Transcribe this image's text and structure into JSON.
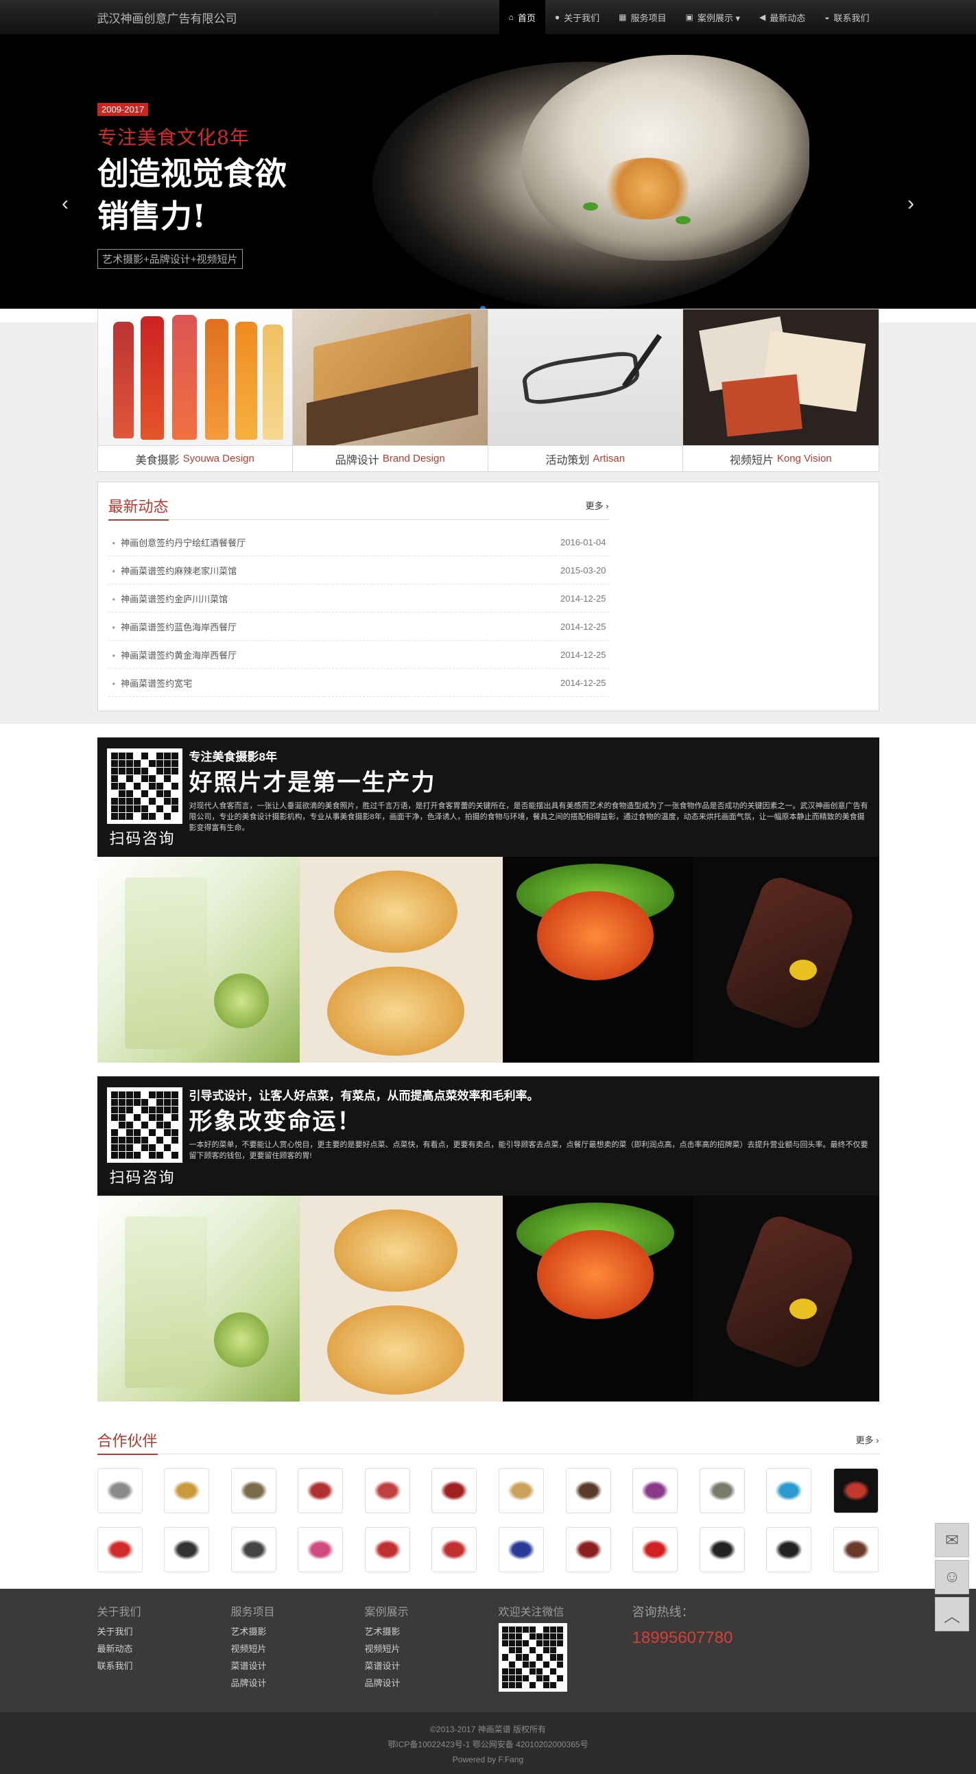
{
  "header": {
    "brand": "武汉神画创意广告有限公司",
    "nav": [
      {
        "label": "首页",
        "icon": "home-icon"
      },
      {
        "label": "关于我们",
        "icon": "user-icon"
      },
      {
        "label": "服务项目",
        "icon": "grid-icon"
      },
      {
        "label": "案例展示 ▾",
        "icon": "image-icon"
      },
      {
        "label": "最新动态",
        "icon": "megaphone-icon"
      },
      {
        "label": "联系我们",
        "icon": "car-icon"
      }
    ]
  },
  "hero": {
    "years": "2009-2017",
    "subtitle": "专注美食文化8年",
    "headline1": "创造视觉食欲",
    "headline2": "销售力!",
    "tag": "艺术摄影+品牌设计+视频短片"
  },
  "cards": [
    {
      "cn": "美食摄影",
      "en": "Syouwa Design"
    },
    {
      "cn": "品牌设计",
      "en": "Brand Design"
    },
    {
      "cn": "活动策划",
      "en": "Artisan"
    },
    {
      "cn": "视频短片",
      "en": "Kong Vision"
    }
  ],
  "news": {
    "title": "最新动态",
    "more": "更多 ›",
    "items": [
      {
        "title": "神画创意签约丹宁绘红酒餐餐厅",
        "date": "2016-01-04"
      },
      {
        "title": "神画菜谱签约麻辣老家川菜馆",
        "date": "2015-03-20"
      },
      {
        "title": "神画菜谱签约金庐川川菜馆",
        "date": "2014-12-25"
      },
      {
        "title": "神画菜谱签约蓝色海岸西餐厅",
        "date": "2014-12-25"
      },
      {
        "title": "神画菜谱签约黄金海岸西餐厅",
        "date": "2014-12-25"
      },
      {
        "title": "神画菜谱签约宽宅",
        "date": "2014-12-25"
      }
    ]
  },
  "promos": [
    {
      "line1": "专注美食摄影8年",
      "line2": "好照片才是第一生产力",
      "scan": "扫码咨询",
      "desc": "对现代人食客而言，一张让人垂涎欲滴的美食照片，胜过千言万语，是打开食客胃蕾的关键所在，是否能摆出具有美感而艺术的食物造型成为了一张食物作品是否成功的关键因素之一。武汉神画创意广告有限公司，专业的美食设计摄影机构，专业从事美食摄影8年，画面干净，色泽诱人，拍摄的食物与环境，餐具之间的搭配相得益彰，通过食物的温度，动态来烘托画面气氛，让一幅原本静止而精致的美食摄影变得富有生命。"
    },
    {
      "line1": "引导式设计，让客人好点菜，有菜点，从而提高点菜效率和毛利率。",
      "line2": "形象改变命运！",
      "scan": "扫码咨询",
      "desc": "一本好的菜单，不要能让人赏心悦目，更主要的是要好点菜、点菜快，有看点，更要有卖点，能引导顾客去点菜，点餐厅最想卖的菜（即利润点高，点击率高的招牌菜）去提升营业额与回头率。最终不仅要留下顾客的钱包，更要留住顾客的胃!"
    }
  ],
  "partners": {
    "title": "合作伙伴",
    "more": "更多 ›",
    "logo_colors": [
      "#8a8a8a",
      "#c89a3a",
      "#7a6b4a",
      "#b03030",
      "#c04040",
      "#a01f1f",
      "#c8a25a",
      "#5a3a2a",
      "#8a3a8a",
      "#7a7a6a",
      "#2a9ad0",
      "#c0392b",
      "#d02a2a",
      "#333333",
      "#444444",
      "#d04a80",
      "#c03030",
      "#c03030",
      "#2a3a9a",
      "#8a1f1f",
      "#d02020",
      "#222222",
      "#222222",
      "#6a3a2a"
    ]
  },
  "footer": {
    "cols": [
      {
        "title": "关于我们",
        "links": [
          "关于我们",
          "最新动态",
          "联系我们"
        ]
      },
      {
        "title": "服务项目",
        "links": [
          "艺术摄影",
          "视频短片",
          "菜谱设计",
          "品牌设计"
        ]
      },
      {
        "title": "案例展示",
        "links": [
          "艺术摄影",
          "视频短片",
          "菜谱设计",
          "品牌设计"
        ]
      }
    ],
    "wechat_title": "欢迎关注微信",
    "hotline_title": "咨询热线：",
    "hotline": "18995607780",
    "copyright": "©2013-2017 神画菜谱 版权所有",
    "icp": "鄂ICP备10022423号-1  鄂公网安备 42010202000365号",
    "powered": "Powered by F.Fang"
  },
  "side": [
    "wechat-icon",
    "qq-icon",
    "back-to-top-icon"
  ]
}
